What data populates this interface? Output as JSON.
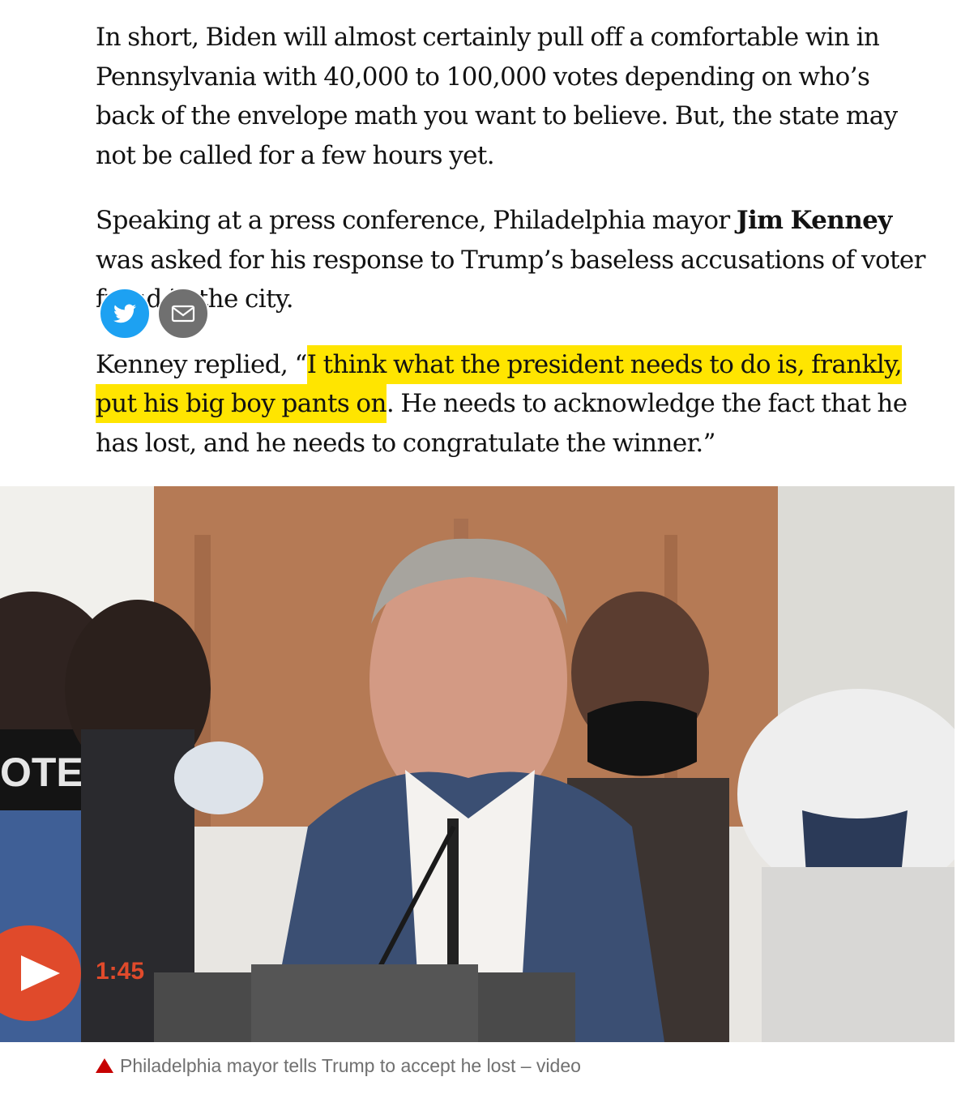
{
  "article": {
    "p1": "In short, Biden will almost certainly pull off a comfortable win in Pennsylvania with 40,000 to 100,000 votes depending on who’s back of the envelope math you want to believe. But, the state may not be called for a few hours yet.",
    "p2_start": "Speaking at a press conference, Philadelphia mayor ",
    "p2_bold": "Jim Kenney",
    "p2_end": " was asked for his response to Trump’s baseless accusations of voter fraud in the city.",
    "p3_start": "Kenney replied, “",
    "p3_highlight": "I think what the president needs to do is, frankly, put his big boy pants on",
    "p3_end": ". He needs to acknowledge the fact that he has lost, and he needs to congratulate the winner.”"
  },
  "share": {
    "twitter_icon": "twitter-icon",
    "email_icon": "email-icon"
  },
  "video": {
    "duration": "1:45",
    "caption": "Philadelphia mayor tells Trump to accept he lost – video",
    "mask_text": "OTE",
    "play_icon": "play-icon",
    "accent_color": "#e04a2b"
  },
  "colors": {
    "highlight": "#ffe500",
    "twitter": "#1da1f2",
    "caption_icon": "#c70000"
  }
}
